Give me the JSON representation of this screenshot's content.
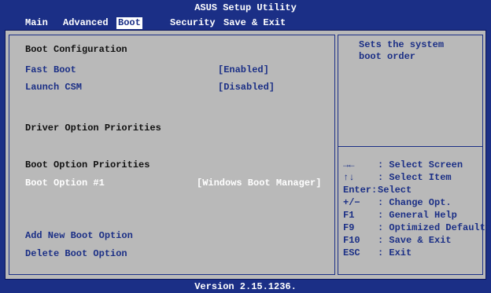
{
  "window": {
    "title": "ASUS Setup Utility"
  },
  "menu": [
    {
      "label": "Main",
      "active": false
    },
    {
      "label": "Advanced",
      "active": false
    },
    {
      "label": "Boot",
      "active": true
    },
    {
      "label": "Security",
      "active": false
    },
    {
      "label": "Save & Exit",
      "active": false
    }
  ],
  "settings": {
    "boot_config_heading": "Boot Configuration",
    "fast_boot": {
      "label": "Fast Boot",
      "value": "[Enabled]"
    },
    "launch_csm": {
      "label": "Launch CSM",
      "value": "[Disabled]"
    },
    "driver_heading": "Driver Option Priorities",
    "boot_priorities_heading": "Boot Option Priorities",
    "boot_option_1": {
      "label": "Boot Option #1",
      "value": "[Windows Boot Manager]"
    },
    "add_new_boot_option": "Add New Boot Option",
    "delete_boot_option": "Delete Boot Option"
  },
  "help": {
    "line1": "Sets the system",
    "line2": "boot order"
  },
  "keys": [
    {
      "key": "→←",
      "desc": ": Select Screen"
    },
    {
      "key": "↑↓",
      "desc": ": Select Item"
    },
    {
      "key": "Enter:",
      "desc": "Select"
    },
    {
      "key": "+/−",
      "desc": ": Change Opt."
    },
    {
      "key": "F1",
      "desc": ": General Help"
    },
    {
      "key": "F9",
      "desc": ": Optimized Defaults"
    },
    {
      "key": "F10",
      "desc": ": Save & Exit"
    },
    {
      "key": "ESC",
      "desc": ": Exit"
    }
  ],
  "footer": {
    "version": "Version 2.15.1236."
  },
  "colors": {
    "background": "#1b2f86",
    "panel": "#b9b9b9",
    "highlight": "#ffffff"
  }
}
